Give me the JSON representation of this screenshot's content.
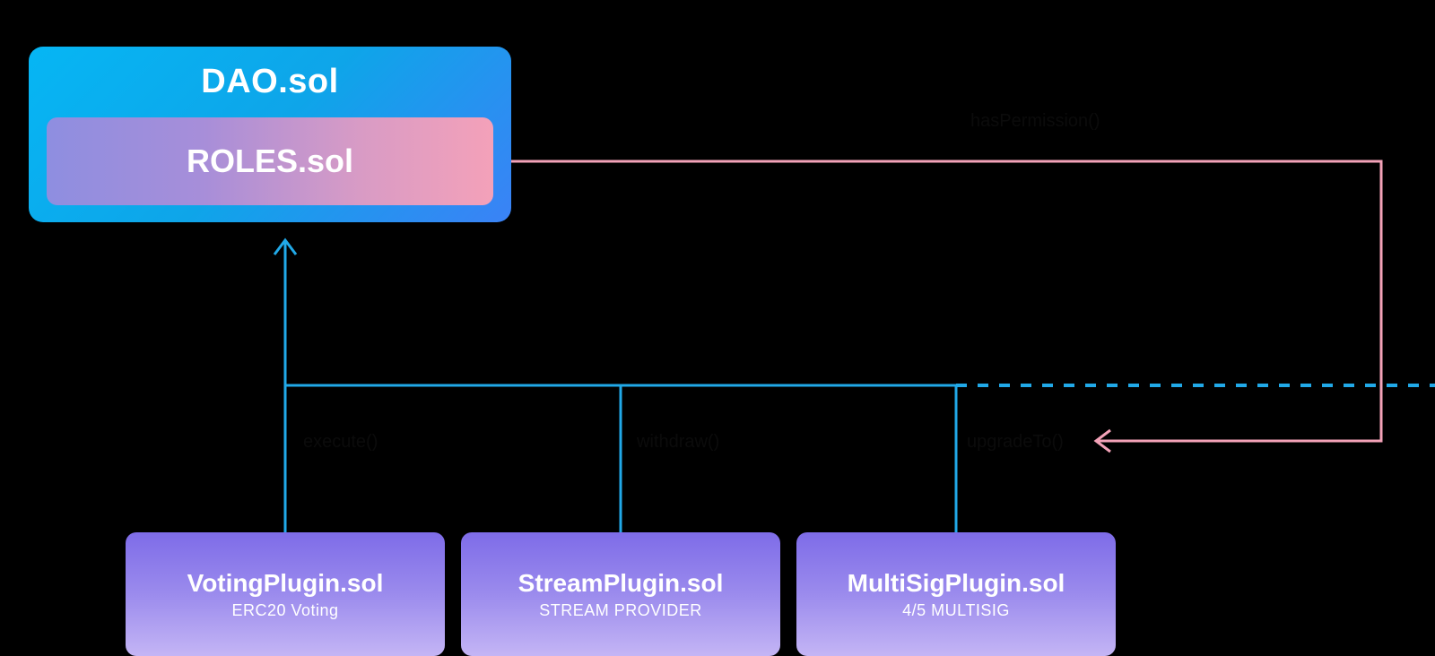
{
  "dao": {
    "title": "DAO.sol",
    "roles": "ROLES.sol"
  },
  "plugins": {
    "voting": {
      "title": "VotingPlugin.sol",
      "subtitle": "ERC20 Voting"
    },
    "stream": {
      "title": "StreamPlugin.sol",
      "subtitle": "STREAM PROVIDER"
    },
    "multisig": {
      "title": "MultiSigPlugin.sol",
      "subtitle": "4/5 MULTISIG"
    }
  },
  "labels": {
    "execute": "execute()",
    "withdraw": "withdraw()",
    "upgrade": "upgradeTo()",
    "has_permission": "hasPermission()"
  },
  "colors": {
    "connector_blue": "#21A9E8",
    "permission_pink": "#F3A2B8"
  }
}
